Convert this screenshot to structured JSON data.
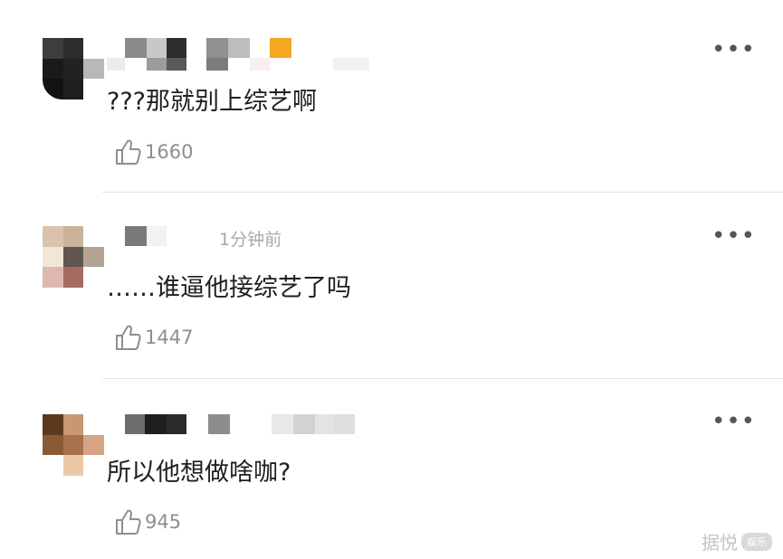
{
  "comments": [
    {
      "time": "",
      "text": "???那就别上综艺啊",
      "likes": "1660"
    },
    {
      "time": "1分钟前",
      "text": "……谁逼他接综艺了吗",
      "likes": "1447"
    },
    {
      "time": "",
      "text": "所以他想做啥咖?",
      "likes": "945"
    }
  ],
  "more_glyph": "•••",
  "watermark": {
    "text": "据悦",
    "badge": "娱乐"
  },
  "colors": {
    "like_icon": "#8e8e8e",
    "time_text": "#a8a8a8",
    "divider": "#e4e4e4"
  }
}
